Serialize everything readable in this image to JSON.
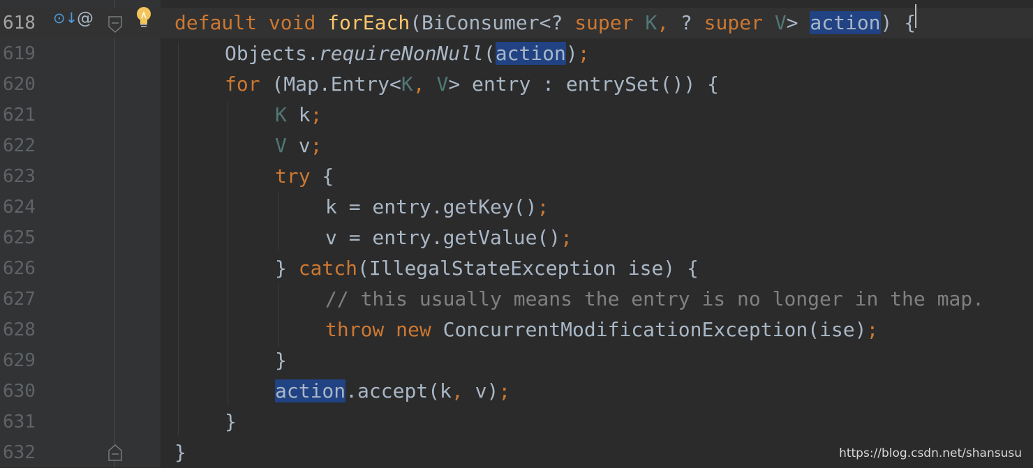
{
  "editor": {
    "lines": [
      {
        "num": "618",
        "tokens": [
          [
            "kw",
            "default"
          ],
          [
            "p",
            " "
          ],
          [
            "kw",
            "void"
          ],
          [
            "p",
            " "
          ],
          [
            "fn",
            "forEach"
          ],
          [
            "p",
            "(BiConsumer<? "
          ],
          [
            "kw",
            "super"
          ],
          [
            "p",
            " "
          ],
          [
            "tp",
            "K"
          ],
          [
            "kw",
            ","
          ],
          [
            "p",
            " ? "
          ],
          [
            "kw",
            "super"
          ],
          [
            "p",
            " "
          ],
          [
            "tp",
            "V"
          ],
          [
            "p",
            "> "
          ],
          [
            "hl",
            "action"
          ],
          [
            "p",
            ") {"
          ]
        ]
      },
      {
        "num": "619",
        "tokens": [
          [
            "p",
            "Objects."
          ],
          [
            "it",
            "requireNonNull"
          ],
          [
            "p",
            "("
          ],
          [
            "hl",
            "action"
          ],
          [
            "p",
            ")"
          ],
          [
            "kw",
            ";"
          ]
        ]
      },
      {
        "num": "620",
        "tokens": [
          [
            "kw",
            "for"
          ],
          [
            "p",
            " (Map.Entry<"
          ],
          [
            "tp",
            "K"
          ],
          [
            "kw",
            ","
          ],
          [
            "p",
            " "
          ],
          [
            "tp",
            "V"
          ],
          [
            "p",
            "> entry : entrySet()) {"
          ]
        ]
      },
      {
        "num": "621",
        "tokens": [
          [
            "tp",
            "K"
          ],
          [
            "p",
            " k"
          ],
          [
            "kw",
            ";"
          ]
        ]
      },
      {
        "num": "622",
        "tokens": [
          [
            "tp",
            "V"
          ],
          [
            "p",
            " v"
          ],
          [
            "kw",
            ";"
          ]
        ]
      },
      {
        "num": "623",
        "tokens": [
          [
            "kw",
            "try"
          ],
          [
            "p",
            " {"
          ]
        ]
      },
      {
        "num": "624",
        "tokens": [
          [
            "p",
            "k = entry.getKey()"
          ],
          [
            "kw",
            ";"
          ]
        ]
      },
      {
        "num": "625",
        "tokens": [
          [
            "p",
            "v = entry.getValue()"
          ],
          [
            "kw",
            ";"
          ]
        ]
      },
      {
        "num": "626",
        "tokens": [
          [
            "p",
            "} "
          ],
          [
            "kw",
            "catch"
          ],
          [
            "p",
            "(IllegalStateException ise) {"
          ]
        ]
      },
      {
        "num": "627",
        "tokens": [
          [
            "cm",
            "// this usually means the entry is no longer in the map."
          ]
        ]
      },
      {
        "num": "628",
        "tokens": [
          [
            "kw",
            "throw"
          ],
          [
            "p",
            " "
          ],
          [
            "kw",
            "new"
          ],
          [
            "p",
            " ConcurrentModificationException(ise)"
          ],
          [
            "kw",
            ";"
          ]
        ]
      },
      {
        "num": "629",
        "tokens": [
          [
            "p",
            "}"
          ]
        ]
      },
      {
        "num": "630",
        "tokens": [
          [
            "hl",
            "action"
          ],
          [
            "p",
            ".accept(k"
          ],
          [
            "kw",
            ","
          ],
          [
            "p",
            " v)"
          ],
          [
            "kw",
            ";"
          ]
        ]
      },
      {
        "num": "631",
        "tokens": [
          [
            "p",
            "}"
          ]
        ]
      },
      {
        "num": "632",
        "tokens": [
          [
            "p",
            "}"
          ]
        ]
      }
    ]
  },
  "gutter_icons": {
    "override": "⊙↓",
    "annotation": "@"
  },
  "watermark": "https://blog.csdn.net/shansusu"
}
